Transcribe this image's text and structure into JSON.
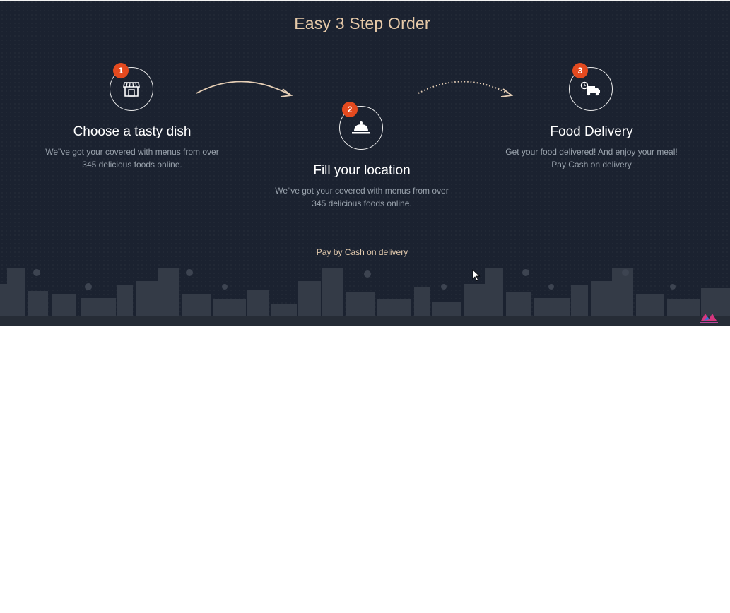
{
  "section": {
    "title": "Easy 3 Step Order",
    "pay_note": "Pay by Cash on delivery"
  },
  "steps": [
    {
      "number": "1",
      "icon": "storefront-icon",
      "title": "Choose a tasty dish",
      "desc_line1": "We\"ve got your covered with menus from over",
      "desc_line2": "345 delicious foods online."
    },
    {
      "number": "2",
      "icon": "cloche-icon",
      "title": "Fill your location",
      "desc_line1": "We\"ve got your covered with menus from over",
      "desc_line2": "345 delicious foods online."
    },
    {
      "number": "3",
      "icon": "delivery-truck-icon",
      "title": "Food Delivery",
      "desc_line1": "Get your food delivered! And enjoy your meal!",
      "desc_line2": "Pay Cash on delivery"
    }
  ],
  "colors": {
    "background": "#1b2230",
    "title": "#e6c9a8",
    "badge": "#e44a1f",
    "description": "#9aa3ad"
  }
}
